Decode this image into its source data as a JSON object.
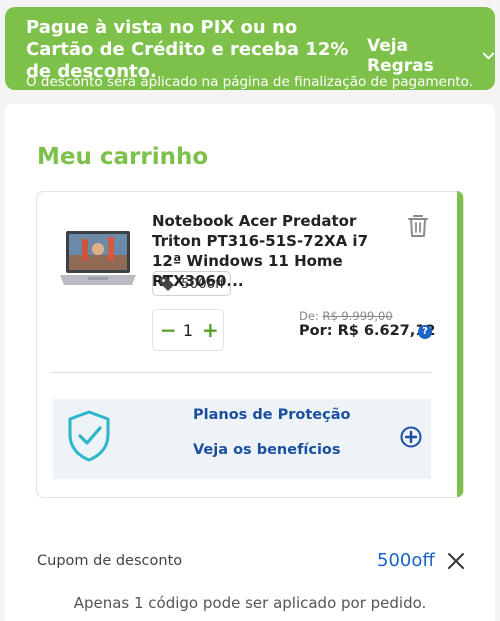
{
  "promo": {
    "title": "Pague à vista no PIX ou no Cartão de Crédito e receba 12% de desconto.",
    "rules_label": "Veja Regras",
    "subtitle": "O desconto será aplicado na página de finalização de pagamento."
  },
  "cart": {
    "title": "Meu carrinho",
    "item": {
      "name": "Notebook Acer Predator Triton PT316-51S-72XA i7 12ª Windows 11 Home RTX3060...",
      "tag": "500off",
      "quantity": "1",
      "quantity_minus": "−",
      "quantity_plus": "+",
      "old_price_prefix": "De: ",
      "old_price": "R$ 9.999,00",
      "price": "Por: R$ 6.627,12"
    },
    "protection": {
      "title": "Planos de Proteção",
      "link": "Veja os benefícios"
    }
  },
  "coupon": {
    "label": "Cupom de desconto",
    "code": "500off",
    "note": "Apenas 1 código pode ser aplicado por pedido."
  },
  "colors": {
    "brand_green": "#7dc14a",
    "link_blue": "#1b4fa0",
    "accent_blue": "#1b63c9"
  }
}
